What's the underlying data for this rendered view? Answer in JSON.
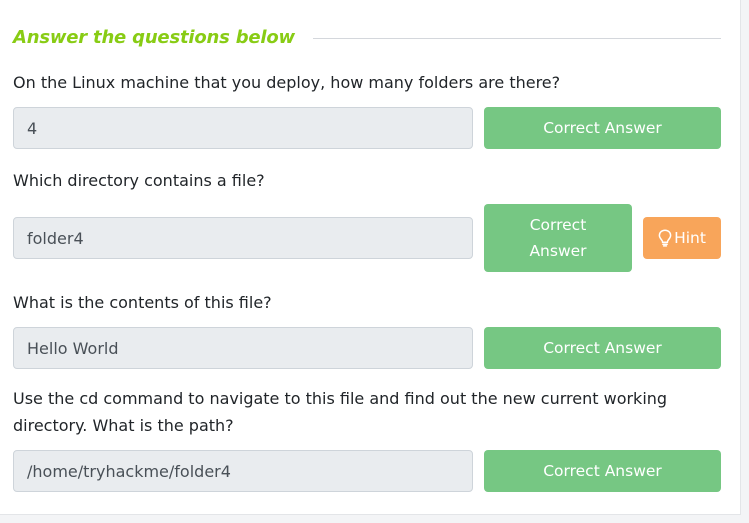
{
  "section": {
    "title": "Answer the questions below"
  },
  "questions": [
    {
      "text": "On the Linux machine that you deploy, how many folders are there?",
      "answer": "4",
      "button": "Correct Answer"
    },
    {
      "text": "Which directory contains a file?",
      "answer": "folder4",
      "button_line1": "Correct",
      "button_line2": "Answer",
      "hint": "Hint"
    },
    {
      "text": "What is the contents of this file?",
      "answer": "Hello World",
      "button": "Correct Answer"
    },
    {
      "text_line1": "Use the cd command to navigate to this file and find out the new current working",
      "text_line2": "directory. What is the path?",
      "answer": "/home/tryhackme/folder4",
      "button": "Correct Answer"
    }
  ],
  "colors": {
    "accent": "#88cc14",
    "correct": "#76c783",
    "hint": "#f8a55a",
    "input_bg": "#e9ecef"
  },
  "icons": {
    "hint": "lightbulb-icon"
  }
}
